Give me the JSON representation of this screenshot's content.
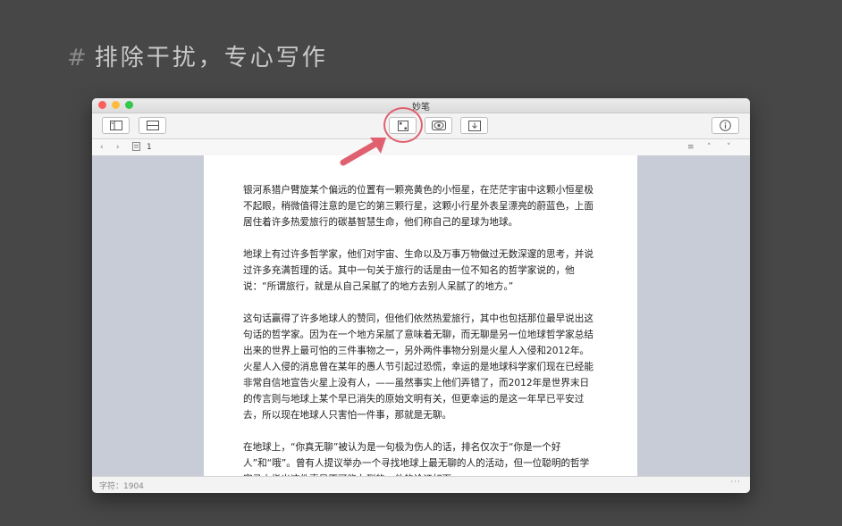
{
  "headline": {
    "hash": "#",
    "text": "排除干扰，专心写作"
  },
  "window": {
    "title": "妙笔"
  },
  "toolbar": {
    "buttons": [
      {
        "name": "sidebar-toggle",
        "icon": "sidebar-icon"
      },
      {
        "name": "layout",
        "icon": "layout-icon"
      },
      {
        "name": "focus-mode",
        "icon": "fullscreen-icon"
      },
      {
        "name": "preview",
        "icon": "eye-icon"
      },
      {
        "name": "export",
        "icon": "download-icon"
      },
      {
        "name": "info",
        "icon": "info-icon"
      }
    ]
  },
  "nav": {
    "page_number": "1"
  },
  "document": {
    "paragraphs": [
      "银河系猎户臂旋某个偏远的位置有一颗亮黄色的小恒星，在茫茫宇宙中这颗小恒星极不起眼，稍微值得注意的是它的第三颗行星，这颗小行星外表呈漂亮的蔚蓝色，上面居住着许多热爱旅行的碳基智慧生命，他们称自己的星球为地球。",
      "地球上有过许多哲学家，他们对宇宙、生命以及万事万物做过无数深邃的思考，并说过许多充满哲理的话。其中一句关于旅行的话是由一位不知名的哲学家说的，他说：“所谓旅行，就是从自己呆腻了的地方去别人呆腻了的地方。”",
      "这句话赢得了许多地球人的赞同，但他们依然热爱旅行，其中也包括那位最早说出这句话的哲学家。因为在一个地方呆腻了意味着无聊，而无聊是另一位地球哲学家总结出来的世界上最可怕的三件事物之一，另外两件事物分别是火星人入侵和2012年。火星人入侵的消息曾在某年的愚人节引起过恐慌，幸运的是地球科学家们现在已经能非常自信地宣告火星上没有人，——虽然事实上他们弄错了，而2012年是世界末日的传言则与地球上某个早已消失的原始文明有关，但更幸运的是这一年早已平安过去，所以现在地球人只害怕一件事，那就是无聊。",
      "在地球上，“你真无聊”被认为是一句极为伤人的话，排名仅次于“你是一个好人”和“哦”。曾有人提议举办一个寻找地球上最无聊的人的活动，但一位聪明的哲学家马上指出这件事是不可能办到的，他的论证如下："
    ]
  },
  "status": {
    "char_count": "字符：1904",
    "more": "···"
  },
  "colors": {
    "accent_annotation": "#e06070",
    "background": "#474747"
  }
}
